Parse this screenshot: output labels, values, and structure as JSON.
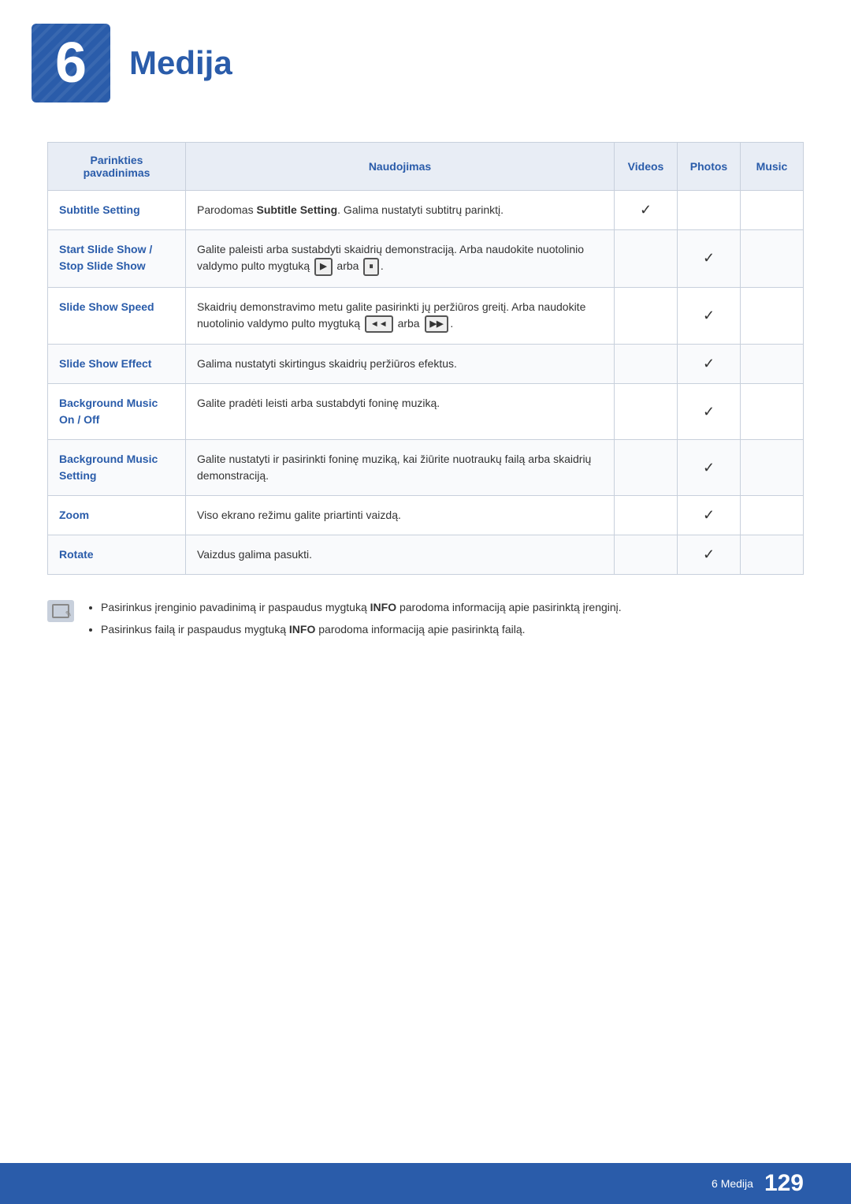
{
  "header": {
    "chapter_number": "6",
    "chapter_title": "Medija"
  },
  "table": {
    "columns": {
      "parinkties": "Parinkties pavadinimas",
      "naudojimas": "Naudojimas",
      "videos": "Videos",
      "photos": "Photos",
      "music": "Music"
    },
    "rows": [
      {
        "id": "subtitle-setting",
        "parinkties": "Subtitle Setting",
        "naudojimas": "Parodomas Subtitle Setting. Galima nustatyti subtitrų parinktį.",
        "naudojimas_bold": [
          "Subtitle Setting"
        ],
        "videos": true,
        "photos": false,
        "music": false
      },
      {
        "id": "start-slide-show",
        "parinkties": "Start Slide Show / Stop Slide Show",
        "naudojimas": "Galite paleisti arba sustabdyti skaidrių demonstraciją. Arba naudokite nuotolinio valdymo pulto mygtuką ▶ arba ⏸.",
        "videos": false,
        "photos": true,
        "music": false
      },
      {
        "id": "slide-show-speed",
        "parinkties": "Slide Show Speed",
        "naudojimas": "Skaidrių demonstravimo metu galite pasirinkti jų peržiūros greitį. Arba naudokite nuotolinio valdymo pulto mygtuką ◄◄ arba ▶▶.",
        "videos": false,
        "photos": true,
        "music": false
      },
      {
        "id": "slide-show-effect",
        "parinkties": "Slide Show Effect",
        "naudojimas": "Galima nustatyti skirtingus skaidrių peržiūros efektus.",
        "videos": false,
        "photos": true,
        "music": false
      },
      {
        "id": "background-music-on-off",
        "parinkties": "Background Music On / Off",
        "naudojimas": "Galite pradėti leisti arba sustabdyti foninę muziką.",
        "videos": false,
        "photos": true,
        "music": false
      },
      {
        "id": "background-music-setting",
        "parinkties": "Background Music Setting",
        "naudojimas": "Galite nustatyti ir pasirinkti foninę muziką, kai žiūrite nuotraukų failą arba skaidrių demonstraciją.",
        "videos": false,
        "photos": true,
        "music": false
      },
      {
        "id": "zoom",
        "parinkties": "Zoom",
        "naudojimas": "Viso ekrano režimu galite priartinti vaizdą.",
        "videos": false,
        "photos": true,
        "music": false
      },
      {
        "id": "rotate",
        "parinkties": "Rotate",
        "naudojimas": "Vaizdus galima pasukti.",
        "videos": false,
        "photos": true,
        "music": false
      }
    ]
  },
  "notes": [
    {
      "text": "Pasirinkus įrenginio pavadinimą ir paspaudus mygtuką INFO parodoma informaciją apie pasirinktą įrenginį.",
      "bold_words": [
        "INFO"
      ]
    },
    {
      "text": "Pasirinkus failą ir paspaudus mygtuką INFO parodoma informaciją apie pasirinktą failą.",
      "bold_words": [
        "INFO"
      ]
    }
  ],
  "footer": {
    "label": "6 Medija",
    "page_number": "129"
  }
}
